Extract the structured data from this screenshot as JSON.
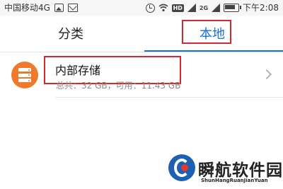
{
  "status_bar": {
    "carrier": "中国移动4G",
    "hd_label": "HD",
    "sim_label": "2G",
    "time": "下午2:08"
  },
  "tabs": [
    {
      "label": "分类",
      "selected": false
    },
    {
      "label": "本地",
      "selected": true
    }
  ],
  "storage": {
    "title": "内部存储",
    "detail": "总共：32 GB，可用：11.43 GB"
  },
  "watermark": {
    "name": "瞬航软件园",
    "pinyin": "ShunHangRuanJianYuan"
  },
  "colors": {
    "accent_blue": "#1a6fd6",
    "highlight_red": "#d7272e",
    "storage_orange": "#f07a2c"
  }
}
